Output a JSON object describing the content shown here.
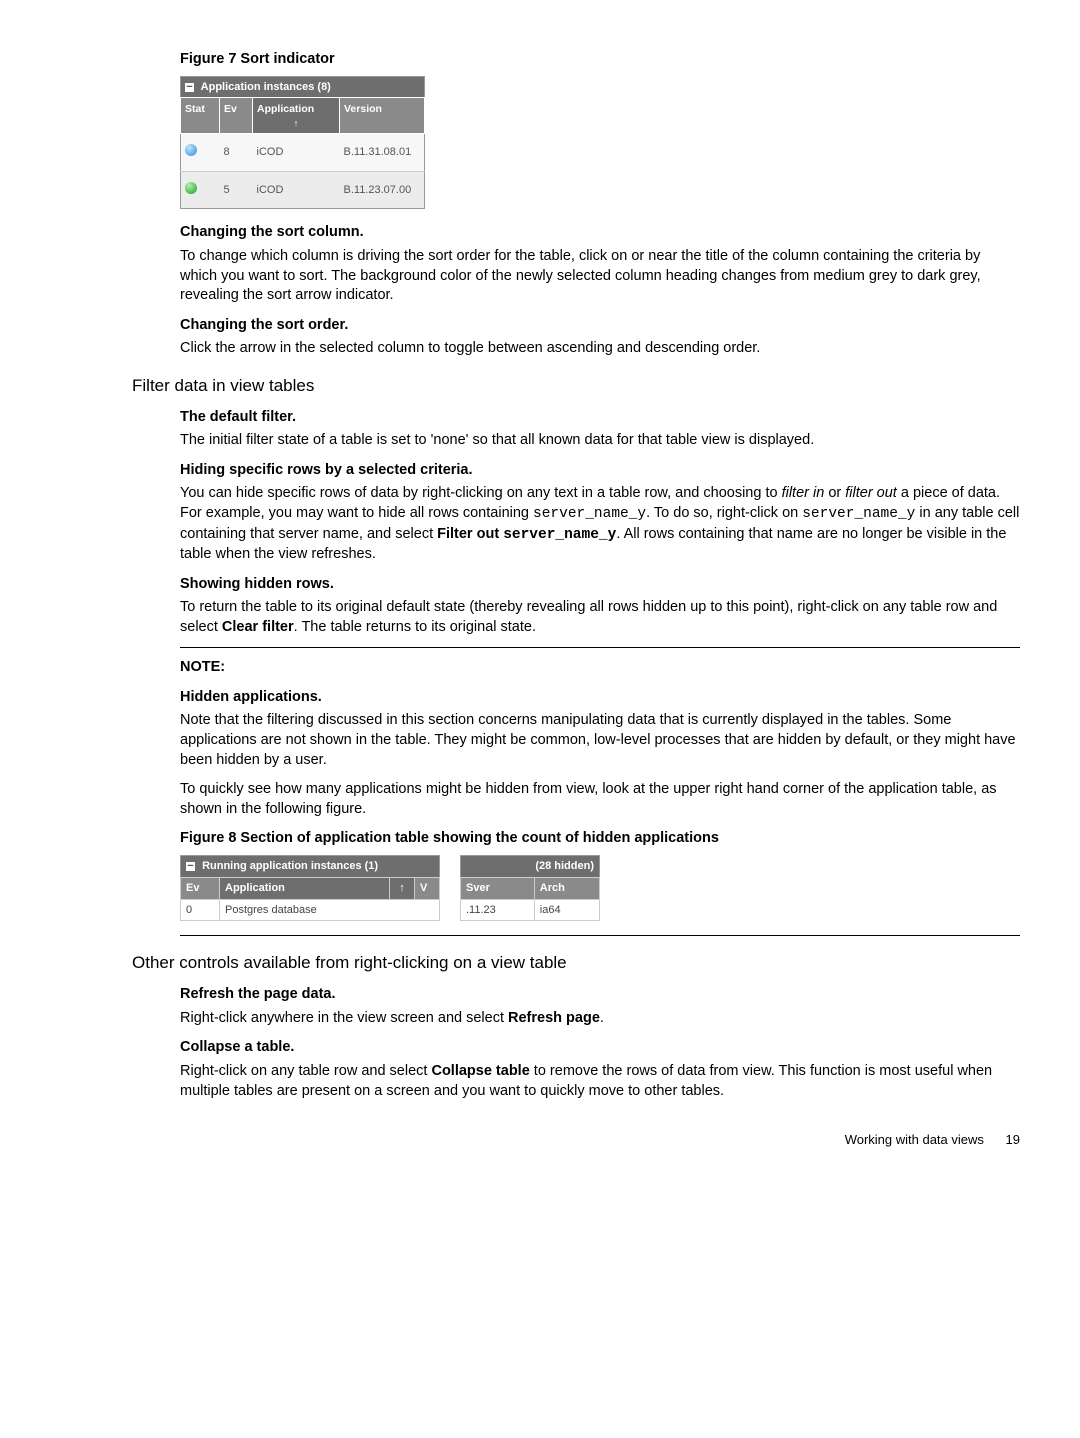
{
  "fig7": {
    "caption": "Figure 7 Sort indicator",
    "title": "Application instances (8)",
    "headers": {
      "stat": "Stat",
      "ev": "Ev",
      "app": "Application",
      "ver": "Version"
    },
    "rows": [
      {
        "ev": "8",
        "app": "iCOD",
        "ver": "B.11.31.08.01"
      },
      {
        "ev": "5",
        "app": "iCOD",
        "ver": "B.11.23.07.00"
      }
    ]
  },
  "changingSortColumn": {
    "heading": "Changing the sort column.",
    "body": "To change which column is driving the sort order for the table, click on or near the title of the column containing the criteria by which you want to sort. The background color of the newly selected column heading changes from medium grey to dark grey, revealing the sort arrow indicator."
  },
  "changingSortOrder": {
    "heading": "Changing the sort order.",
    "body": "Click the arrow in the selected column to toggle between ascending and descending order."
  },
  "filterHeading": "Filter data in view tables",
  "defaultFilter": {
    "heading": "The default filter.",
    "body": "The initial filter state of a table is set to 'none' so that all known data for that table view is displayed."
  },
  "hidingRows": {
    "heading": "Hiding specific rows by a selected criteria.",
    "p1a": "You can hide specific rows of data by right-clicking on any text in a table row, and choosing to ",
    "filterIn": "filter in",
    "or": " or ",
    "filterOut": "filter out",
    "p1b": " a piece of data. For example, you may want to hide all rows containing ",
    "code1": "server_name_y",
    "p1c": ". To do so, right-click on ",
    "code2": "server_name_y",
    "p1d": " in any table cell containing that server name, and select ",
    "filterOutBold": "Filter out ",
    "codeBold": "server_name_y",
    "p1e": ". All rows containing that name are no longer be visible in the table when the view refreshes."
  },
  "showingHidden": {
    "heading": "Showing hidden rows.",
    "p1a": "To return the table to its original default state (thereby revealing all rows hidden up to this point), right-click on any table row and select ",
    "clearFilter": "Clear filter",
    "p1b": ". The table returns to its original state."
  },
  "note": {
    "label": "NOTE:",
    "heading": "Hidden applications.",
    "p1": "Note that the filtering discussed in this section concerns manipulating data that is currently displayed in the tables. Some applications are not shown in the table. They might be common, low-level processes that are hidden by default, or they might have been hidden by a user.",
    "p2": "To quickly see how many applications might be hidden from view, look at the upper right hand corner of the application table, as shown in the following figure."
  },
  "fig8": {
    "caption": "Figure 8 Section of application table showing the count of hidden applications",
    "left": {
      "title": "Running application instances (1)",
      "headers": {
        "ev": "Ev",
        "app": "Application",
        "arrow": "↑",
        "v": "V"
      },
      "row": {
        "ev": "0",
        "app": "Postgres database"
      }
    },
    "right": {
      "title": "(28 hidden)",
      "headers": {
        "sver": "Sver",
        "arch": "Arch"
      },
      "row": {
        "sver": ".11.23",
        "arch": "ia64"
      }
    }
  },
  "otherControlsHeading": "Other controls available from right-clicking on a view table",
  "refresh": {
    "heading": "Refresh the page data.",
    "p1a": "Right-click anywhere in the view screen and select ",
    "refreshPage": "Refresh page",
    "p1b": "."
  },
  "collapse": {
    "heading": "Collapse a table.",
    "p1a": "Right-click on any table row and select ",
    "collapseTable": "Collapse table",
    "p1b": " to remove the rows of data from view. This function is most useful when multiple tables are present on a screen and you want to quickly move to other tables."
  },
  "footer": {
    "text": "Working with data views",
    "page": "19"
  }
}
